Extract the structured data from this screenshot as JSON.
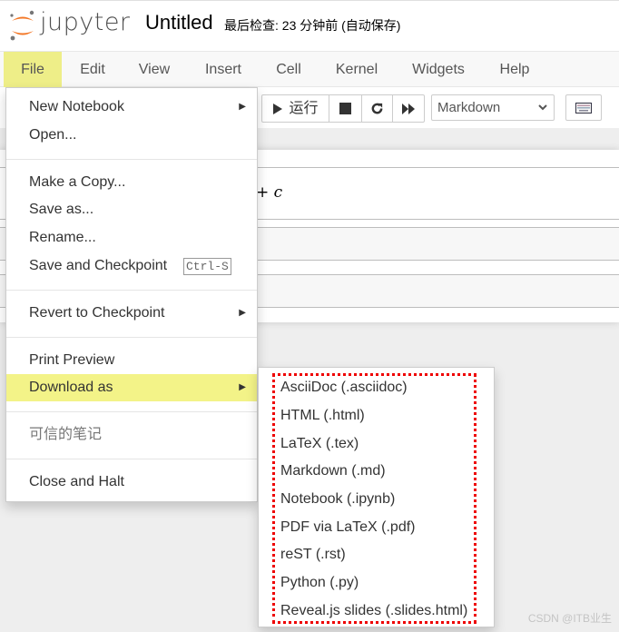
{
  "header": {
    "logo_text": "jupyter",
    "notebook_title": "Untitled",
    "checkpoint_status": "最后检查: 23 分钟前  (自动保存)"
  },
  "menubar": {
    "items": [
      {
        "label": "File",
        "active": true
      },
      {
        "label": "Edit"
      },
      {
        "label": "View"
      },
      {
        "label": "Insert"
      },
      {
        "label": "Cell"
      },
      {
        "label": "Kernel"
      },
      {
        "label": "Widgets"
      },
      {
        "label": "Help"
      }
    ]
  },
  "toolbar": {
    "run_label": "运行",
    "run_icon": "play-icon",
    "stop_icon": "stop-icon",
    "restart_icon": "restart-icon",
    "fast_forward_icon": "fast-forward-icon",
    "cell_type_selected": "Markdown",
    "keyboard_icon": "keyboard-icon"
  },
  "notebook": {
    "math_fragment": "+ c"
  },
  "file_menu": {
    "items": [
      {
        "label": "New Notebook",
        "has_submenu": true
      },
      {
        "label": "Open..."
      },
      {
        "label": "Make a Copy..."
      },
      {
        "label": "Save as..."
      },
      {
        "label": "Rename..."
      },
      {
        "label": "Save and Checkpoint",
        "shortcut": "Ctrl-S"
      },
      {
        "label": "Revert to Checkpoint",
        "has_submenu": true
      },
      {
        "label": "Print Preview"
      },
      {
        "label": "Download as",
        "has_submenu": true,
        "active": true
      },
      {
        "label": "可信的笔记",
        "disabled": true
      },
      {
        "label": "Close and Halt"
      }
    ]
  },
  "download_submenu": {
    "items": [
      {
        "label": "AsciiDoc (.asciidoc)"
      },
      {
        "label": "HTML (.html)"
      },
      {
        "label": "LaTeX (.tex)"
      },
      {
        "label": "Markdown (.md)"
      },
      {
        "label": "Notebook (.ipynb)"
      },
      {
        "label": "PDF via LaTeX (.pdf)"
      },
      {
        "label": "reST (.rst)"
      },
      {
        "label": "Python (.py)"
      },
      {
        "label": "Reveal.js slides (.slides.html)"
      }
    ],
    "highlight_color": "#ee0000"
  },
  "colors": {
    "menu_active": "#eeee88",
    "logo_orange": "#f37726",
    "logo_grey": "#767677"
  },
  "watermark": "CSDN @ITB业生"
}
